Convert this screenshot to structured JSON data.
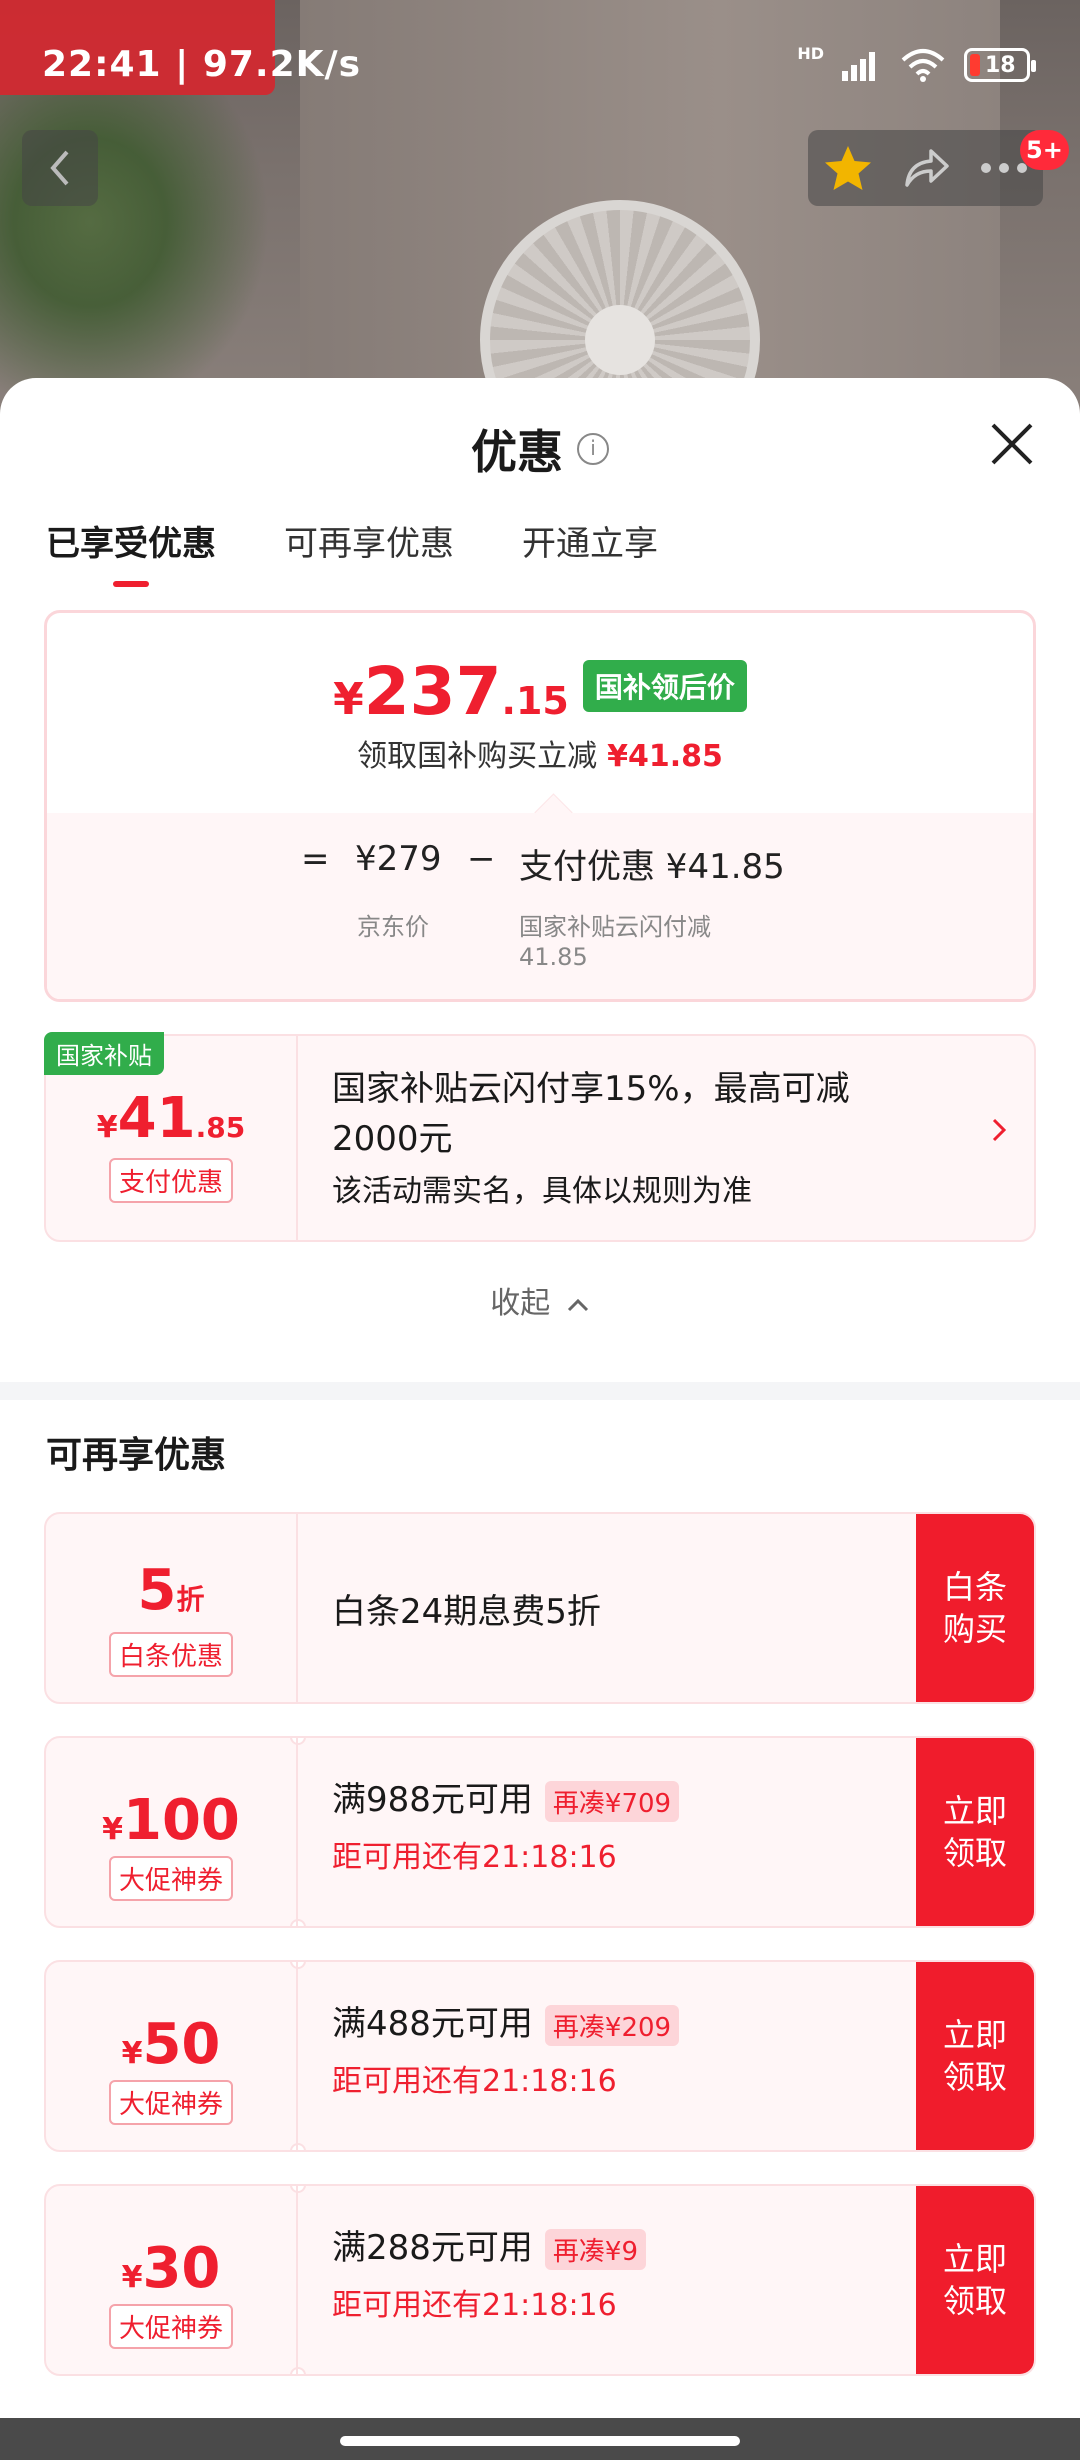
{
  "status_bar": {
    "time": "22:41",
    "speed": "97.2K/s",
    "network": "HD",
    "battery": "18"
  },
  "top_nav": {
    "badge": "5+"
  },
  "sheet": {
    "title": "优惠",
    "tabs": [
      {
        "label": "已享受优惠",
        "active": true
      },
      {
        "label": "可再享优惠",
        "active": false
      },
      {
        "label": "开通立享",
        "active": false
      }
    ],
    "summary": {
      "price_yen": "¥",
      "price_int": "237",
      "price_dec": ".15",
      "price_tag": "国补领后价",
      "subtitle": "领取国补购买立减",
      "subtitle_amount": "¥41.85",
      "eq_symbol": "=",
      "jd_price": "¥279",
      "jd_price_label": "京东价",
      "minus_symbol": "−",
      "discount": "支付优惠 ¥41.85",
      "discount_label_1": "国家补贴云闪付减",
      "discount_label_2": "41.85"
    },
    "gov_card": {
      "badge": "国家补贴",
      "amount_yen": "¥",
      "amount_int": "41",
      "amount_dec": ".85",
      "tag": "支付优惠",
      "title": "国家补贴云闪付享15%，最高可减2000元",
      "desc": "该活动需实名，具体以规则为准"
    },
    "collapse_label": "收起",
    "section_title": "可再享优惠",
    "coupons": [
      {
        "amount": "5",
        "unit": "折",
        "tag": "白条优惠",
        "title": "白条24期息费5折",
        "extra": "",
        "sub": "",
        "button": "白条\n购买"
      },
      {
        "yen": "¥",
        "amount": "100",
        "tag": "大促神券",
        "title": "满988元可用",
        "extra": "再凑¥709",
        "sub": "距可用还有21:18:16",
        "button": "立即\n领取"
      },
      {
        "yen": "¥",
        "amount": "50",
        "tag": "大促神券",
        "title": "满488元可用",
        "extra": "再凑¥209",
        "sub": "距可用还有21:18:16",
        "button": "立即\n领取"
      },
      {
        "yen": "¥",
        "amount": "30",
        "tag": "大促神券",
        "title": "满288元可用",
        "extra": "再凑¥9",
        "sub": "距可用还有21:18:16",
        "button": "立即\n领取"
      }
    ]
  },
  "colors": {
    "accent": "#ef1f2f",
    "green_tag": "#31ad4b",
    "card_bg": "#fff6f7"
  }
}
